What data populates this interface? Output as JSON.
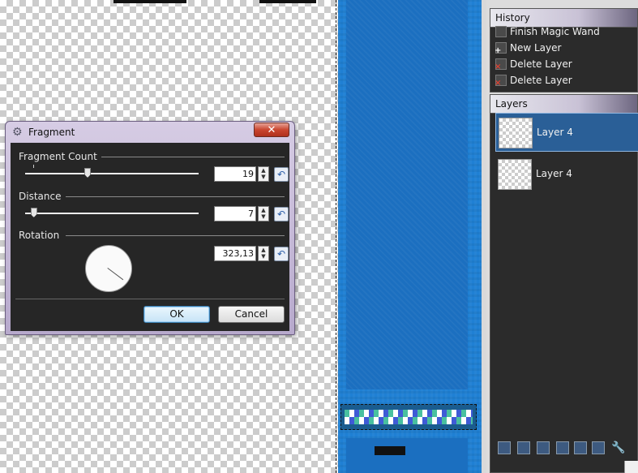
{
  "dialog": {
    "title": "Fragment",
    "icon": "gear-icon",
    "close_icon": "close-icon",
    "close_glyph": "✕",
    "sections": {
      "fragment_count": {
        "label": "Fragment Count",
        "value": "19",
        "slider_fraction": 0.36
      },
      "distance": {
        "label": "Distance",
        "value": "7",
        "slider_fraction": 0.05
      },
      "rotation": {
        "label": "Rotation",
        "value": "323,13",
        "angle_degrees": 323.13
      }
    },
    "reset_glyph": "↶",
    "ok_label": "OK",
    "cancel_label": "Cancel"
  },
  "history": {
    "title": "History",
    "items": [
      {
        "label": "Finish Magic Wand",
        "icon": "magic-wand-icon"
      },
      {
        "label": "New Layer",
        "icon": "new-layer-icon",
        "mark": "+"
      },
      {
        "label": "Delete Layer",
        "icon": "delete-layer-icon",
        "mark": "×"
      },
      {
        "label": "Delete Layer",
        "icon": "delete-layer-icon",
        "mark": "×"
      }
    ]
  },
  "layers": {
    "title": "Layers",
    "items": [
      {
        "label": "Layer 4",
        "selected": true
      },
      {
        "label": "Layer 4",
        "selected": false
      }
    ],
    "tools": [
      "add-layer-icon",
      "delete-layer-icon",
      "duplicate-layer-icon",
      "merge-down-icon",
      "move-up-icon",
      "move-down-icon",
      "properties-icon"
    ]
  },
  "colors": {
    "canvas_blue": "#1f80d4",
    "selection_blue": "#2a5f97",
    "panel_bg": "#2b2b2b",
    "dialog_frame": "#c4b8d8"
  }
}
